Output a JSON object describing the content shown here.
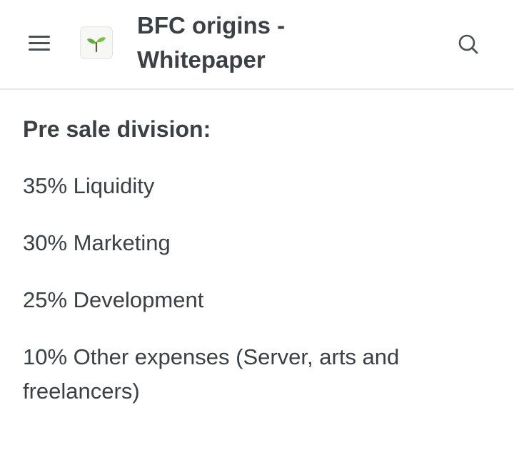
{
  "header": {
    "title_line1": "BFC origins -",
    "title_line2": "Whitepaper",
    "menu_icon": "hamburger-menu-icon",
    "logo_icon": "seedling-icon",
    "search_icon": "search-icon"
  },
  "content": {
    "heading": "Pre sale division:",
    "items": [
      "35% Liquidity",
      "30% Marketing",
      "25% Development",
      "10% Other expenses (Server, arts and freelancers)"
    ]
  },
  "colors": {
    "text": "#3b4045",
    "divider": "#e6e8ea",
    "leaf": "#5fae2e"
  }
}
